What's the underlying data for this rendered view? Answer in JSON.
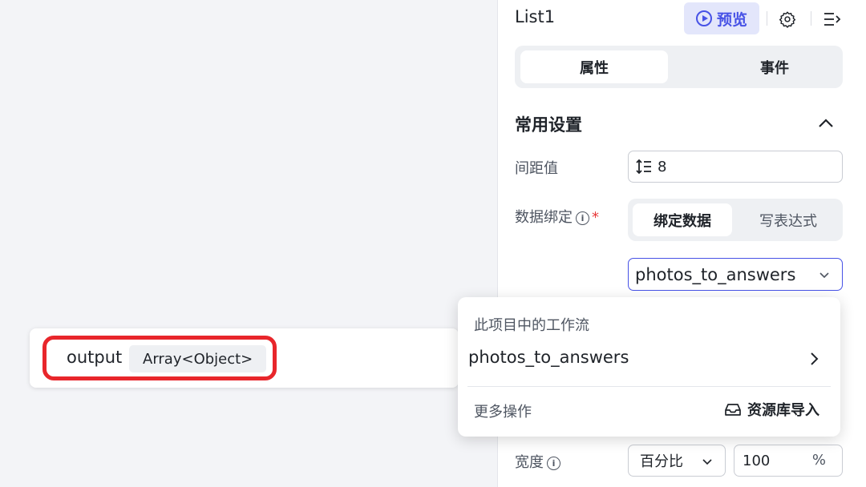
{
  "panel": {
    "title": "List1",
    "preview_label": "预览",
    "tabs": [
      {
        "label": "属性",
        "active": true
      },
      {
        "label": "事件",
        "active": false
      }
    ],
    "section_title": "常用设置",
    "spacing": {
      "label": "间距值",
      "value": "8"
    },
    "data_binding": {
      "label": "数据绑定",
      "required_mark": "*",
      "info_glyph": "i",
      "modes": [
        "绑定数据",
        "写表达式"
      ],
      "active_mode": "绑定数据",
      "selected_workflow": "photos_to_answers"
    },
    "width": {
      "label": "宽度",
      "info_glyph": "i",
      "unit_type": "百分比",
      "value": "100",
      "unit_symbol": "%"
    }
  },
  "output_node": {
    "name": "output",
    "type": "Array<Object>"
  },
  "workflow_dropdown": {
    "caption": "此项目中的工作流",
    "items": [
      "photos_to_answers"
    ],
    "more_label": "更多操作",
    "import_label": "资源库导入"
  },
  "colors": {
    "accent": "#4752e6",
    "accent_bg": "#e3e6fb",
    "highlight": "#e8262b",
    "required": "#e83a3a"
  }
}
